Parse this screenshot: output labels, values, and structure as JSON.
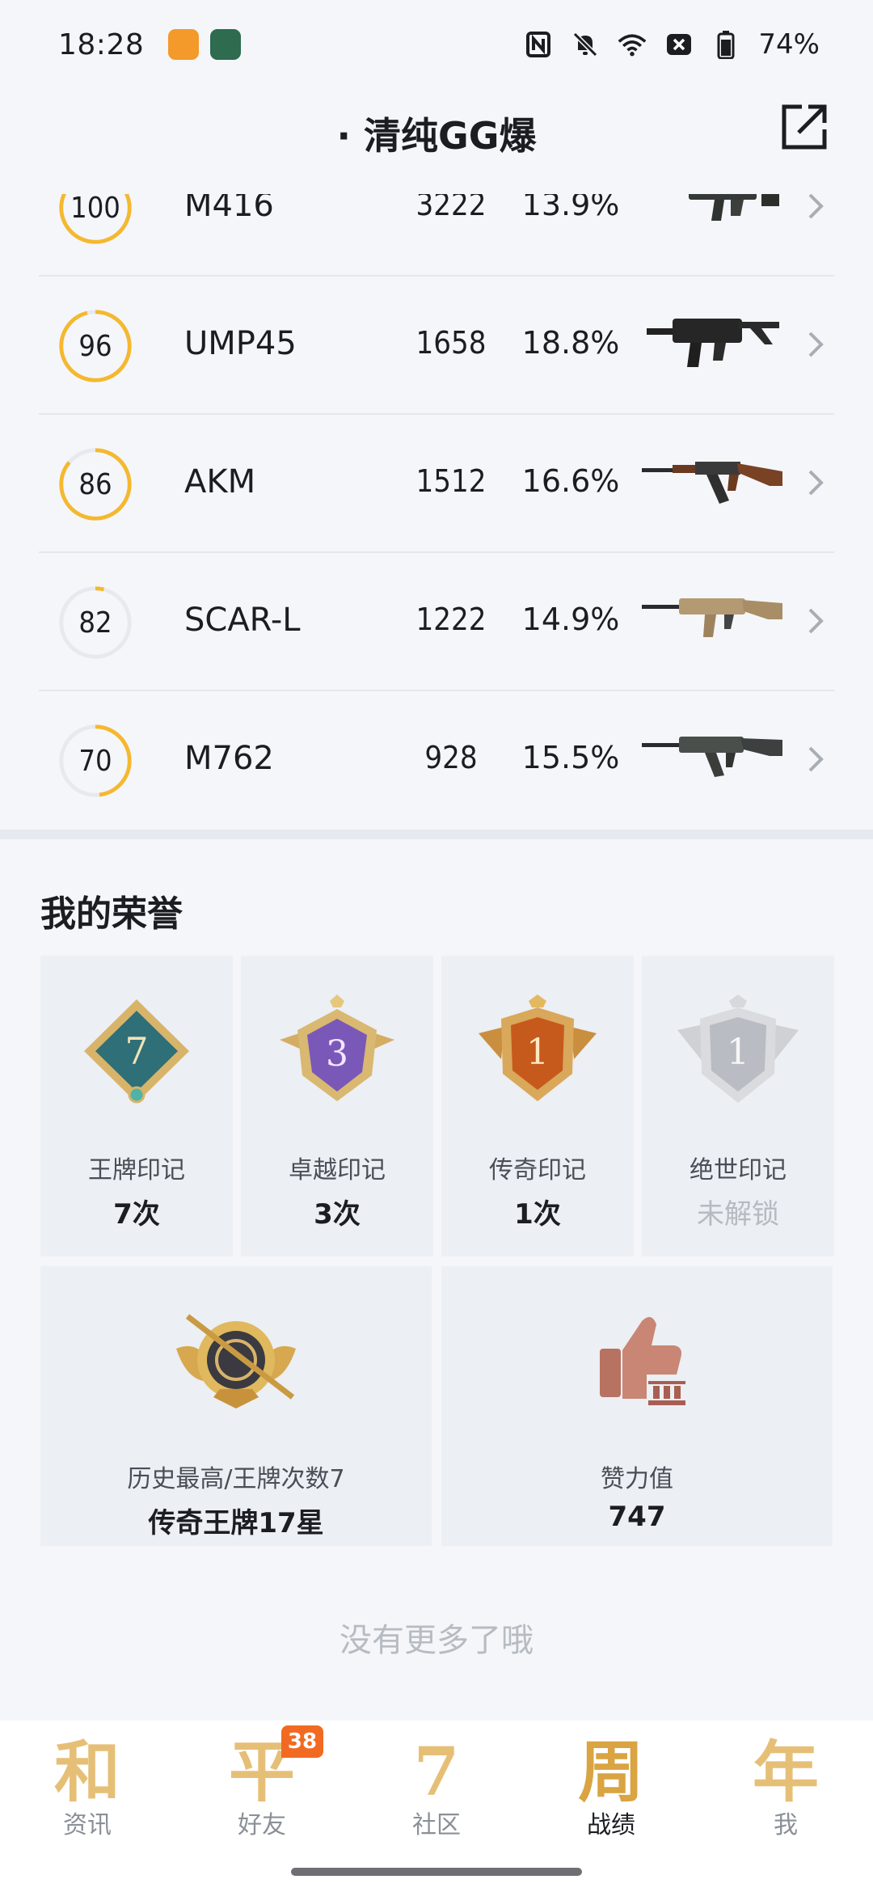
{
  "status_bar": {
    "time": "18:28",
    "battery": "74%",
    "icons": [
      "nfc-icon",
      "mute-icon",
      "wifi-icon",
      "sim-off-icon",
      "battery-icon"
    ]
  },
  "header": {
    "title": "· 清纯GG爆",
    "share_icon": "external-share-icon"
  },
  "weapons": [
    {
      "score": "100",
      "score_pct": 100,
      "name": "M416",
      "kills": "3222",
      "rate": "13.9%"
    },
    {
      "score": "96",
      "score_pct": 96,
      "name": "UMP45",
      "kills": "1658",
      "rate": "18.8%"
    },
    {
      "score": "86",
      "score_pct": 86,
      "name": "AKM",
      "kills": "1512",
      "rate": "16.6%"
    },
    {
      "score": "82",
      "score_pct": 4,
      "name": "SCAR-L",
      "kills": "1222",
      "rate": "14.9%"
    },
    {
      "score": "70",
      "score_pct": 48,
      "name": "M762",
      "kills": "928",
      "rate": "15.5%"
    }
  ],
  "honors": {
    "title": "我的荣誉",
    "medals": [
      {
        "label": "王牌印记",
        "count": "7次",
        "badge": "7",
        "color": "#2e6f78"
      },
      {
        "label": "卓越印记",
        "count": "3次",
        "badge": "3",
        "color": "#7a58b8"
      },
      {
        "label": "传奇印记",
        "count": "1次",
        "badge": "1",
        "color": "#c65a1c"
      },
      {
        "label": "绝世印记",
        "count": "未解锁",
        "badge": "1",
        "color": "#b9bcc2"
      }
    ],
    "highest": {
      "label": "历史最高/王牌次数7",
      "value": "传奇王牌17星"
    },
    "likes": {
      "label": "赞力值",
      "value": "747"
    },
    "no_more": "没有更多了哦"
  },
  "tabs": [
    {
      "glyph": "和",
      "label": "资讯",
      "active": false
    },
    {
      "glyph": "平",
      "label": "好友",
      "active": false,
      "badge": "38"
    },
    {
      "glyph": "7",
      "label": "社区",
      "active": false
    },
    {
      "glyph": "周",
      "label": "战绩",
      "active": true
    },
    {
      "glyph": "年",
      "label": "我",
      "active": false
    }
  ]
}
